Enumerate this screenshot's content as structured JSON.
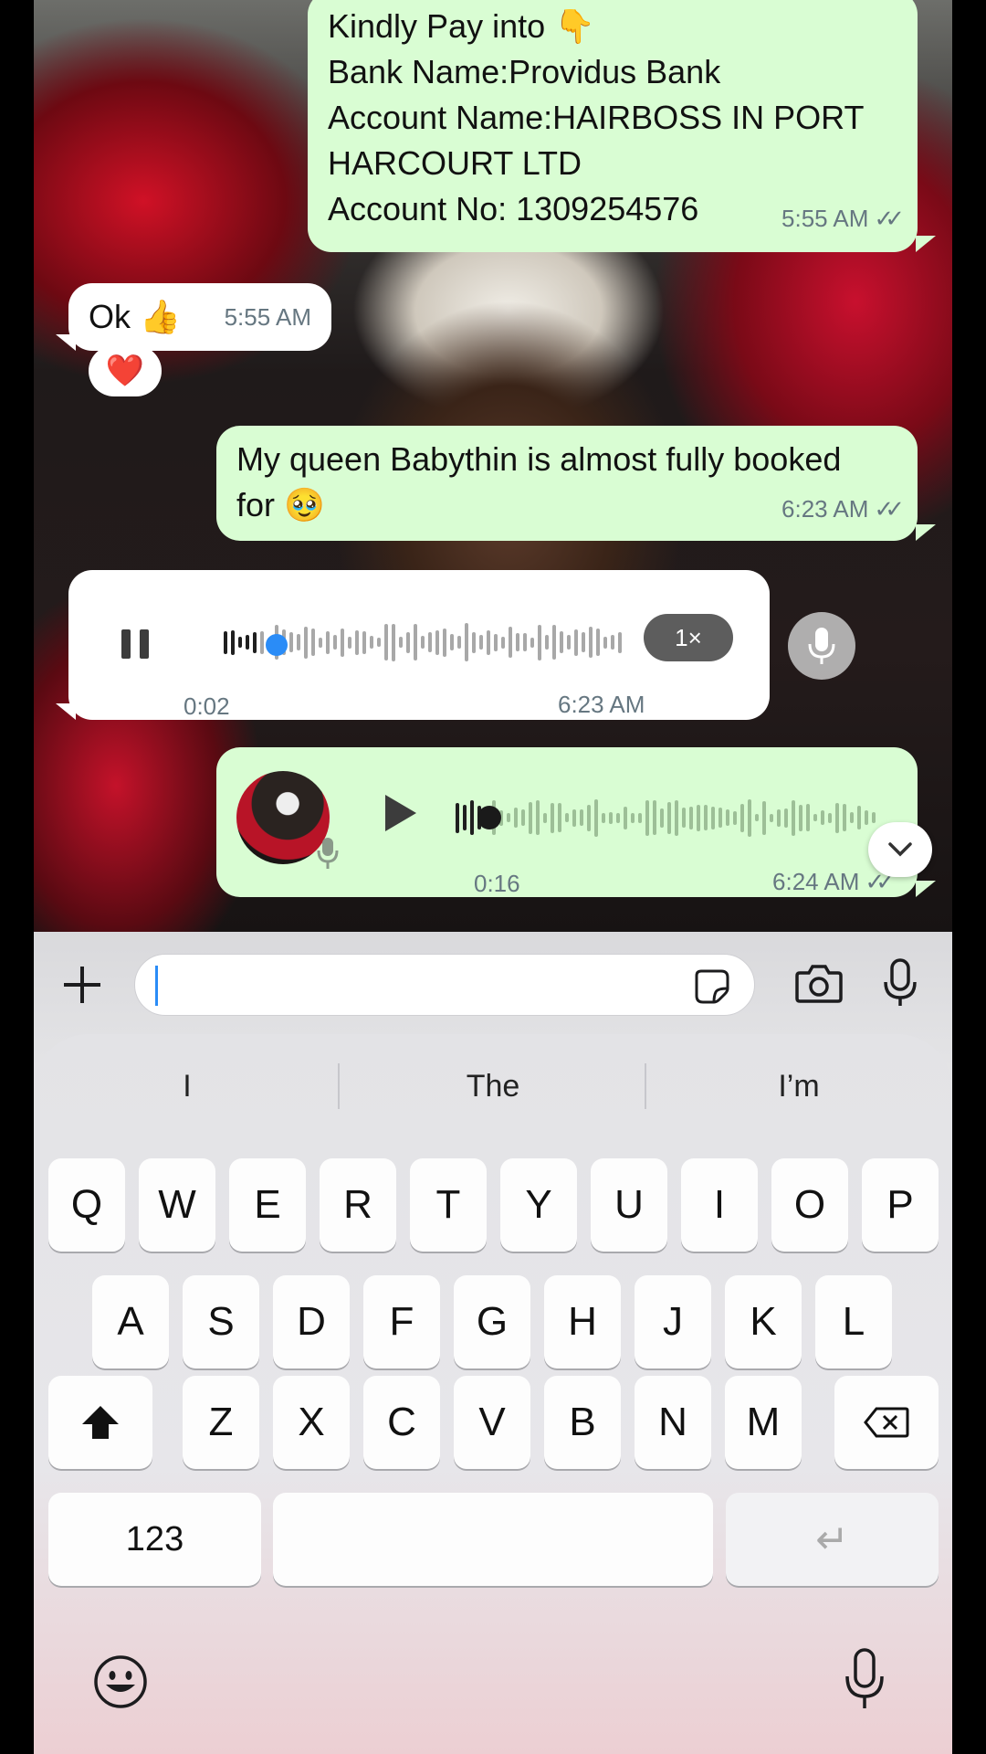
{
  "chat": {
    "msg_bank": {
      "lines": [
        "Kindly Pay into 👇",
        "Bank Name:Providus Bank",
        "Account Name:HAIRBOSS IN PORT",
        "HARCOURT LTD",
        "Account No: 1309254576"
      ],
      "time": "5:55 AM",
      "status": "✓✓"
    },
    "msg_ok": {
      "text": "Ok 👍",
      "time": "5:55 AM",
      "reaction": "❤️"
    },
    "msg_queen": {
      "lines": [
        "My queen Babythin is almost fully booked",
        "for 🥹"
      ],
      "time": "6:23 AM",
      "status": "✓✓"
    },
    "voice_in": {
      "state": "playing",
      "elapsed": "0:02",
      "time": "6:23 AM",
      "speed": "1×",
      "progress": 0.08
    },
    "voice_out": {
      "state": "paused",
      "duration": "0:16",
      "time": "6:24 AM",
      "status": "✓✓",
      "progress": 0.06
    }
  },
  "composer": {
    "text": "",
    "suggestions": [
      "I",
      "The",
      "I’m"
    ]
  },
  "keyboard": {
    "row1": [
      "Q",
      "W",
      "E",
      "R",
      "T",
      "Y",
      "U",
      "I",
      "O",
      "P"
    ],
    "row2": [
      "A",
      "S",
      "D",
      "F",
      "G",
      "H",
      "J",
      "K",
      "L"
    ],
    "row3": [
      "Z",
      "X",
      "C",
      "V",
      "B",
      "N",
      "M"
    ],
    "numbers_label": "123",
    "return_symbol": "↵"
  },
  "colors": {
    "outgoing_bubble": "#d9fdd3",
    "incoming_bubble": "#ffffff",
    "accent_blue": "#2a8cf7"
  }
}
